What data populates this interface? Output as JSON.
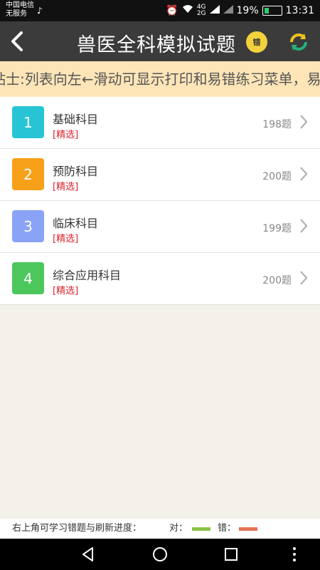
{
  "status_bar": {
    "carrier_line1": "中国电信",
    "carrier_line2": "无服务",
    "net_top": "4G",
    "net_bottom": "2G",
    "battery": "19%",
    "time": "13:31"
  },
  "header": {
    "title": "兽医全科模拟试题",
    "wrong_badge": "错",
    "back_icon": "back-arrow-icon",
    "refresh_icon": "refresh-icon"
  },
  "tip": {
    "text": "贴士:列表向左←滑动可显示打印和易错练习菜单，易"
  },
  "subjects": [
    {
      "num": "1",
      "name": "基础科目",
      "tag": "[精选]",
      "count": "198题",
      "color": "#27c4d6"
    },
    {
      "num": "2",
      "name": "预防科目",
      "tag": "[精选]",
      "count": "200题",
      "color": "#f7a01a"
    },
    {
      "num": "3",
      "name": "临床科目",
      "tag": "[精选]",
      "count": "199题",
      "color": "#8aa3f7"
    },
    {
      "num": "4",
      "name": "综合应用科目",
      "tag": "[精选]",
      "count": "200题",
      "color": "#4cc75c"
    }
  ],
  "footer": {
    "hint": "右上角可学习错题与刷新进度：",
    "right_label": "对：",
    "wrong_label": "错：",
    "right_color": "#8bc34a",
    "wrong_color": "#e57356"
  },
  "colors": {
    "appbar": "#3b3b3b",
    "tip_bg": "#fde5b7",
    "page_bg": "#f4f1ea",
    "tag": "#d9232e"
  }
}
